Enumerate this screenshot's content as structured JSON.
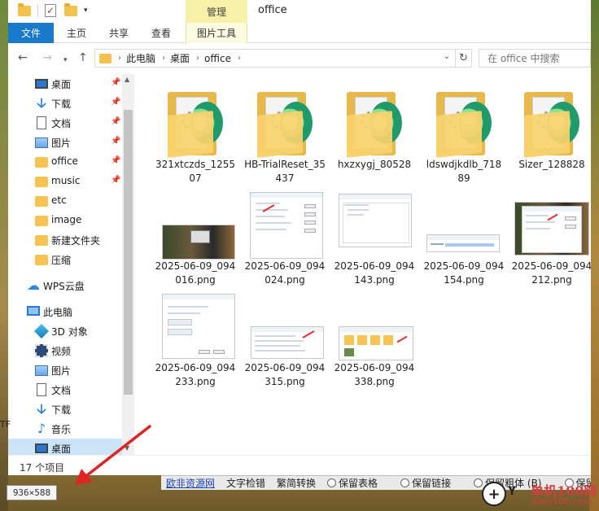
{
  "titlebar": {
    "manage_tab": "管理",
    "title": "office"
  },
  "ribbon": {
    "tabs": [
      {
        "label": "文件"
      },
      {
        "label": "主页"
      },
      {
        "label": "共享"
      },
      {
        "label": "查看"
      },
      {
        "label": "图片工具"
      }
    ]
  },
  "address": {
    "crumbs": [
      "此电脑",
      "桌面",
      "office"
    ]
  },
  "search": {
    "placeholder": "在 office 中搜索"
  },
  "nav": {
    "items": [
      {
        "label": "桌面",
        "icon": "desktop-icon",
        "pinned": true
      },
      {
        "label": "下载",
        "icon": "download-icon",
        "pinned": true
      },
      {
        "label": "文档",
        "icon": "document-icon",
        "pinned": true
      },
      {
        "label": "图片",
        "icon": "pictures-icon",
        "pinned": true
      },
      {
        "label": "office",
        "icon": "folder-icon",
        "pinned": true
      },
      {
        "label": "music",
        "icon": "folder-icon",
        "pinned": true
      },
      {
        "label": "etc",
        "icon": "folder-icon",
        "pinned": false
      },
      {
        "label": "image",
        "icon": "folder-icon",
        "pinned": false
      },
      {
        "label": "新建文件夹",
        "icon": "folder-icon",
        "pinned": false
      },
      {
        "label": "压缩",
        "icon": "folder-icon",
        "pinned": false
      },
      {
        "label": "WPS云盘",
        "icon": "cloud-icon",
        "pinned": false
      },
      {
        "label": "此电脑",
        "icon": "computer-icon",
        "pinned": false
      },
      {
        "label": "3D 对象",
        "icon": "3d-objects-icon",
        "pinned": false
      },
      {
        "label": "视频",
        "icon": "video-icon",
        "pinned": false
      },
      {
        "label": "图片",
        "icon": "pictures-icon",
        "pinned": false
      },
      {
        "label": "文档",
        "icon": "document-icon",
        "pinned": false
      },
      {
        "label": "下载",
        "icon": "download-icon",
        "pinned": false
      },
      {
        "label": "音乐",
        "icon": "music-icon",
        "pinned": false
      },
      {
        "label": "桌面",
        "icon": "desktop-icon",
        "pinned": false,
        "selected": true
      }
    ]
  },
  "files": {
    "folders": [
      {
        "name": "321xtczds_125507"
      },
      {
        "name": "HB-TrialReset_35437"
      },
      {
        "name": "hxzxygj_80528"
      },
      {
        "name": "ldswdjkdlb_71889"
      },
      {
        "name": "Sizer_128828"
      }
    ],
    "images": [
      {
        "name": "2025-06-09_094016.png"
      },
      {
        "name": "2025-06-09_094024.png"
      },
      {
        "name": "2025-06-09_094143.png"
      },
      {
        "name": "2025-06-09_094154.png"
      },
      {
        "name": "2025-06-09_094212.png"
      },
      {
        "name": "2025-06-09_094233.png"
      },
      {
        "name": "2025-06-09_094315.png"
      },
      {
        "name": "2025-06-09_094338.png"
      }
    ],
    "partial_next": "2"
  },
  "status": {
    "item_count": "17 个项目"
  },
  "overlay": {
    "dimensions": "936×588",
    "left_edge_text": "TF"
  },
  "taskstrip": {
    "items": [
      "欧非资源网",
      "文字检错",
      "繁简转换",
      "保留表格",
      "保留链接",
      "保留粗体 (B)",
      "保留粗体"
    ]
  },
  "watermark": {
    "line1": "单机100网",
    "line2": "danji100.com"
  },
  "colors": {
    "file_tab": "#1979ca",
    "manage_tab": "#f7f0a8",
    "selection": "#cce4f7",
    "folder": "#f2c14e",
    "arrow": "#e02424"
  }
}
